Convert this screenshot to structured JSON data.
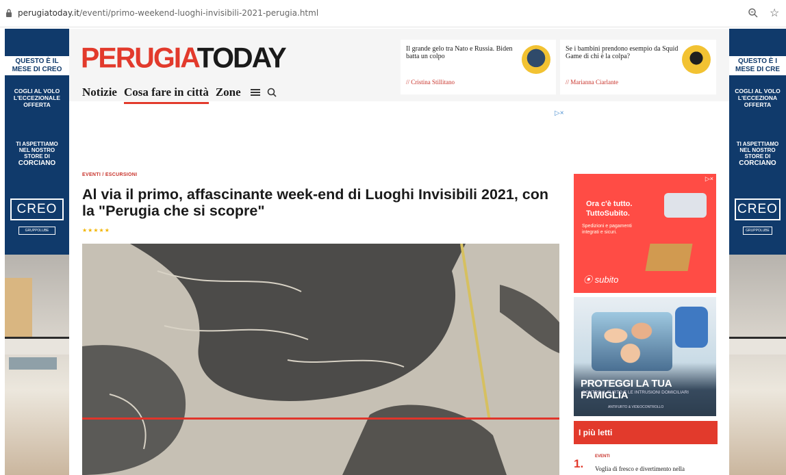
{
  "browser": {
    "url_domain": "perugiatoday.it",
    "url_path": "/eventi/primo-weekend-luoghi-invisibili-2021-perugia.html"
  },
  "colors": {
    "brand_red": "#e23a2c",
    "skin_blue": "#103a6b"
  },
  "skin": {
    "headline": [
      "QUESTO È IL",
      "MESE DI CREO"
    ],
    "offer": [
      "COGLI AL VOLO",
      "L'ECCEZIONALE",
      "OFFERTA"
    ],
    "store": [
      "TI ASPETTIAMO",
      "NEL NOSTRO",
      "STORE DI"
    ],
    "store_city": "CORCIANO",
    "brand": "CREO",
    "brand_sub": "GRUPPOLUBE",
    "right_headline": [
      "QUESTO È I",
      "MESE DI CRE"
    ],
    "right_offer": [
      "COGLI AL VOLO",
      "L'ECCEZIONA",
      "OFFERTA"
    ],
    "right_store": [
      "TI ASPETTIAMO",
      "NEL NOSTRO",
      "STORE DI"
    ],
    "right_city": "CORCIANO",
    "right_brand": "CREO"
  },
  "logo": {
    "part1": "PERUGIA",
    "part2": "TODAY"
  },
  "nav": {
    "item1": "Notizie",
    "item2": "Cosa fare in città",
    "item3": "Zone"
  },
  "news": [
    {
      "title": "Il grande gelo tra Nato e Russia. Biden batta un colpo",
      "author": "Cristina Stillitano"
    },
    {
      "title": "Se i bambini prendono esempio da Squid Game di chi è la colpa?",
      "author": "Marianna Ciarlante"
    }
  ],
  "ad": {
    "choice": "▷×"
  },
  "article": {
    "category": "EVENTI / ESCURSIONI",
    "title": "Al via il primo, affascinante week-end di Luoghi Invisibili 2021, con la \"Perugia che si scopre\"",
    "stars": "★★★★★"
  },
  "sidebar": {
    "ad1_text1": "Ora c'è tutto.",
    "ad1_text2": "TuttoSubito.",
    "ad1_small1": "Spedizioni e pagamenti",
    "ad1_small2": "integrati e sicuri.",
    "ad1_brand": "subito",
    "ad2_title": "PROTEGGI LA TUA FAMIGLIA",
    "ad2_sub": "CONTRO IL FURTO E LE INTRUSIONI DOMICILIARI",
    "ad2_sub2": "ANTIFURTO & VIDEOCONTROLLO",
    "mostread_title": "I più letti",
    "mostread_item1_num": "1.",
    "mostread_item1_cat": "EVENTI",
    "mostread_item1_title": "Voglia di fresco e divertimento nella"
  }
}
